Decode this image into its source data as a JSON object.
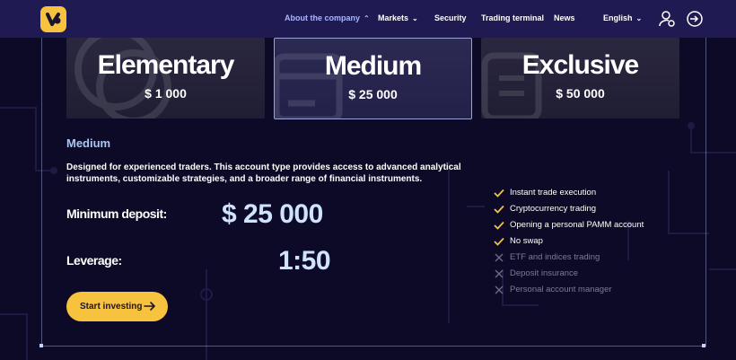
{
  "nav": {
    "items": [
      {
        "label": "About the company",
        "chevron": "chevron-up",
        "active": true
      },
      {
        "label": "Markets",
        "chevron": "chevron-down",
        "active": false
      },
      {
        "label": "Security",
        "chevron": "",
        "active": false
      },
      {
        "label": "Trading terminal",
        "chevron": "",
        "active": false
      },
      {
        "label": "News",
        "chevron": "",
        "active": false
      }
    ],
    "language": "English",
    "icons": [
      "user-settings-icon",
      "login-icon"
    ]
  },
  "cards": [
    {
      "title": "Elementary",
      "price": "$ 1 000",
      "icon": "coin-icon"
    },
    {
      "title": "Medium",
      "price": "$ 25 000",
      "icon": "card-icon"
    },
    {
      "title": "Exclusive",
      "price": "$ 50 000",
      "icon": "bars-icon"
    }
  ],
  "detail": {
    "name": "Medium",
    "description": "Designed for experienced traders. This account type provides access to advanced analytical instruments, customizable strategies, and a broader range of financial instruments.",
    "min_deposit_label": "Minimum deposit:",
    "min_deposit_value": "$ 25 000",
    "leverage_label": "Leverage:",
    "leverage_value": "1:50",
    "cta_label": "Start investing"
  },
  "features": [
    {
      "text": "Instant trade execution",
      "included": true
    },
    {
      "text": "Cryptocurrency trading",
      "included": true
    },
    {
      "text": "Opening a personal PAMM account",
      "included": true
    },
    {
      "text": "No swap",
      "included": true
    },
    {
      "text": "ETF and indices trading",
      "included": false
    },
    {
      "text": "Deposit insurance",
      "included": false
    },
    {
      "text": "Personal account manager",
      "included": false
    }
  ],
  "colors": {
    "accent": "#f7c23e",
    "nav_bg": "#1f1a52",
    "page_bg": "#0c0a26",
    "active_link": "#a9b6ff",
    "value_text": "#cfe3ff"
  }
}
